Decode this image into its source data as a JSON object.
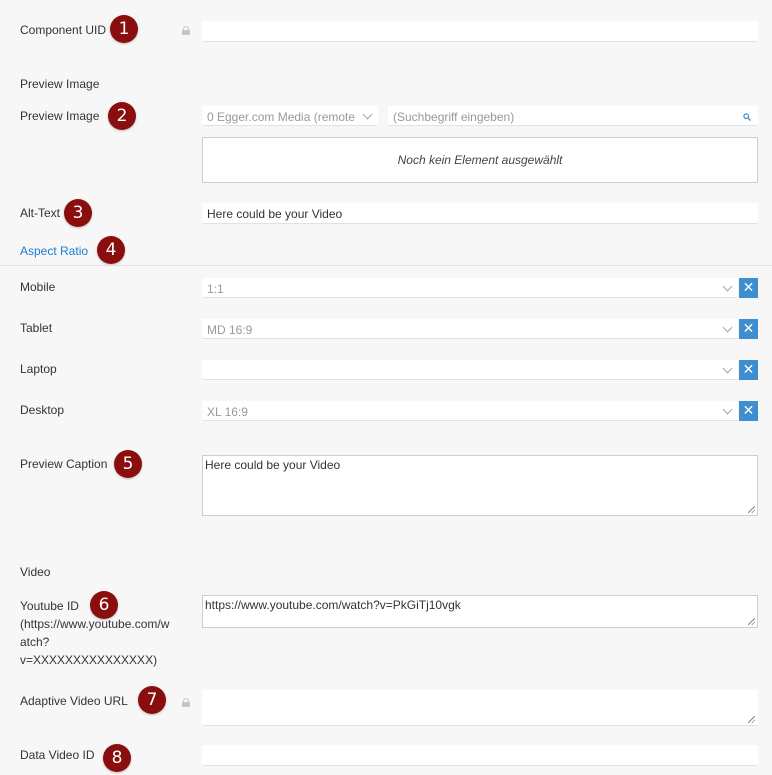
{
  "component_uid": {
    "label": "Component UID",
    "badge": "1",
    "value": ""
  },
  "preview_image_section": {
    "heading": "Preview Image"
  },
  "preview_image": {
    "label": "Preview Image",
    "badge": "2",
    "storage_select": "0 Egger.com Media (remote",
    "search_placeholder": "(Suchbegriff eingeben)",
    "empty_text": "Noch kein Element ausgewählt"
  },
  "alt_text": {
    "label": "Alt-Text",
    "badge": "3",
    "value": "Here could be your Video"
  },
  "aspect_ratio": {
    "heading": "Aspect Ratio",
    "badge": "4",
    "rows": [
      {
        "label": "Mobile",
        "value": "1:1"
      },
      {
        "label": "Tablet",
        "value": "MD 16:9"
      },
      {
        "label": "Laptop",
        "value": ""
      },
      {
        "label": "Desktop",
        "value": "XL 16:9"
      }
    ],
    "clear_symbol": "✕"
  },
  "preview_caption": {
    "label": "Preview Caption",
    "badge": "5",
    "value": "Here could be your Video"
  },
  "video_section": {
    "heading": "Video"
  },
  "youtube_id": {
    "label_line1": "Youtube ID",
    "label_line2": "(https://www.youtube.com/w",
    "label_line3": "atch?",
    "label_line4": "v=XXXXXXXXXXXXXXX)",
    "badge": "6",
    "value": "https://www.youtube.com/watch?v=PkGiTj10vgk"
  },
  "adaptive_video_url": {
    "label": "Adaptive Video URL",
    "badge": "7",
    "value": ""
  },
  "data_video_id": {
    "label": "Data Video ID",
    "badge": "8",
    "value": ""
  },
  "colors": {
    "badge": "#8b0e0e",
    "link": "#1a7fd0",
    "clear_button": "#3e8ed0"
  }
}
